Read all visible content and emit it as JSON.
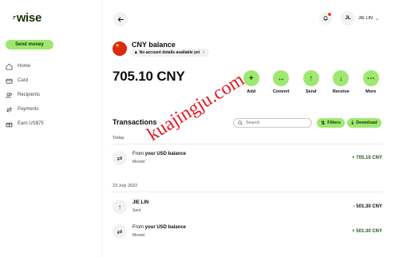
{
  "sidebar": {
    "logo": "wise",
    "send_money": "Send money",
    "items": [
      {
        "label": "Home",
        "icon": "home-icon"
      },
      {
        "label": "Card",
        "icon": "card-icon"
      },
      {
        "label": "Recipients",
        "icon": "recipients-icon"
      },
      {
        "label": "Payments",
        "icon": "payments-icon"
      },
      {
        "label": "Earn US$75",
        "icon": "gift-icon"
      }
    ]
  },
  "header": {
    "user_initials": "JL",
    "user_name": "JIE LIN"
  },
  "balance": {
    "title": "CNY balance",
    "account_pill": "No account details available yet",
    "amount": "705.10 CNY"
  },
  "actions": [
    {
      "label": "Add",
      "icon": "+"
    },
    {
      "label": "Convert",
      "icon": "↔"
    },
    {
      "label": "Send",
      "icon": "↑"
    },
    {
      "label": "Receive",
      "icon": "↓"
    },
    {
      "label": "More",
      "icon": "⋯"
    }
  ],
  "transactions": {
    "title": "Transactions",
    "search_placeholder": "Search",
    "filters_label": "Filters",
    "download_label": "Download",
    "groups": [
      {
        "date": "Today",
        "items": [
          {
            "prefix": "From ",
            "name": "your USD balance",
            "sub": "Moved",
            "amount": "+ 705.10 CNY",
            "direction": "in",
            "icon": "⇄"
          }
        ]
      },
      {
        "date": "23 July 2022",
        "items": [
          {
            "prefix": "",
            "name": "JIE LIN",
            "sub": "Sent",
            "amount": "- 501.30 CNY",
            "direction": "out",
            "icon": "↑"
          },
          {
            "prefix": "From ",
            "name": "your USD balance",
            "sub": "Moved",
            "amount": "+ 501.30 CNY",
            "direction": "in",
            "icon": "⇄"
          }
        ]
      }
    ]
  },
  "watermark": "kuajingju.com",
  "colors": {
    "accent": "#9fe870",
    "brand_dark": "#163300",
    "positive": "#2f5711",
    "watermark": "#e0000f"
  }
}
